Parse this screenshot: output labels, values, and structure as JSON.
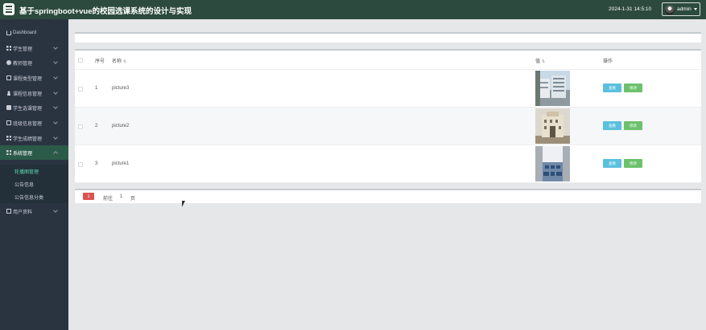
{
  "header": {
    "title": "基于springboot+vue的校园选课系统的设计与实现",
    "clock": "2024-1-31 14:5:10",
    "username": "admin"
  },
  "sidebar": {
    "items": [
      {
        "label": "Dashboard",
        "icon": "home-icon"
      },
      {
        "label": "学生管理",
        "icon": "grid-icon"
      },
      {
        "label": "教师管理",
        "icon": "dot-icon"
      },
      {
        "label": "课程类型管理",
        "icon": "doc-icon"
      },
      {
        "label": "课程信息管理",
        "icon": "user-icon"
      },
      {
        "label": "学生选课管理",
        "icon": "bag-icon"
      },
      {
        "label": "班级信息管理",
        "icon": "doc-icon"
      },
      {
        "label": "学生成绩管理",
        "icon": "grid-icon"
      },
      {
        "label": "系统管理",
        "icon": "grid-icon"
      },
      {
        "label": "用户资料",
        "icon": "doc-icon"
      }
    ],
    "submenu": [
      "轮播图管理",
      "公告信息",
      "公告信息分类"
    ]
  },
  "table": {
    "headers": {
      "index": "序号",
      "name": "名称",
      "value": "值",
      "actions": "操作"
    },
    "rows": [
      {
        "index": "1",
        "name": "picture3",
        "view": "查看",
        "edit": "修改"
      },
      {
        "index": "2",
        "name": "picture2",
        "view": "查看",
        "edit": "修改"
      },
      {
        "index": "3",
        "name": "picture1",
        "view": "查看",
        "edit": "修改"
      }
    ]
  },
  "pagination": {
    "current": "1",
    "goto_label": "前往",
    "page_value": "1",
    "page_unit": "页"
  }
}
